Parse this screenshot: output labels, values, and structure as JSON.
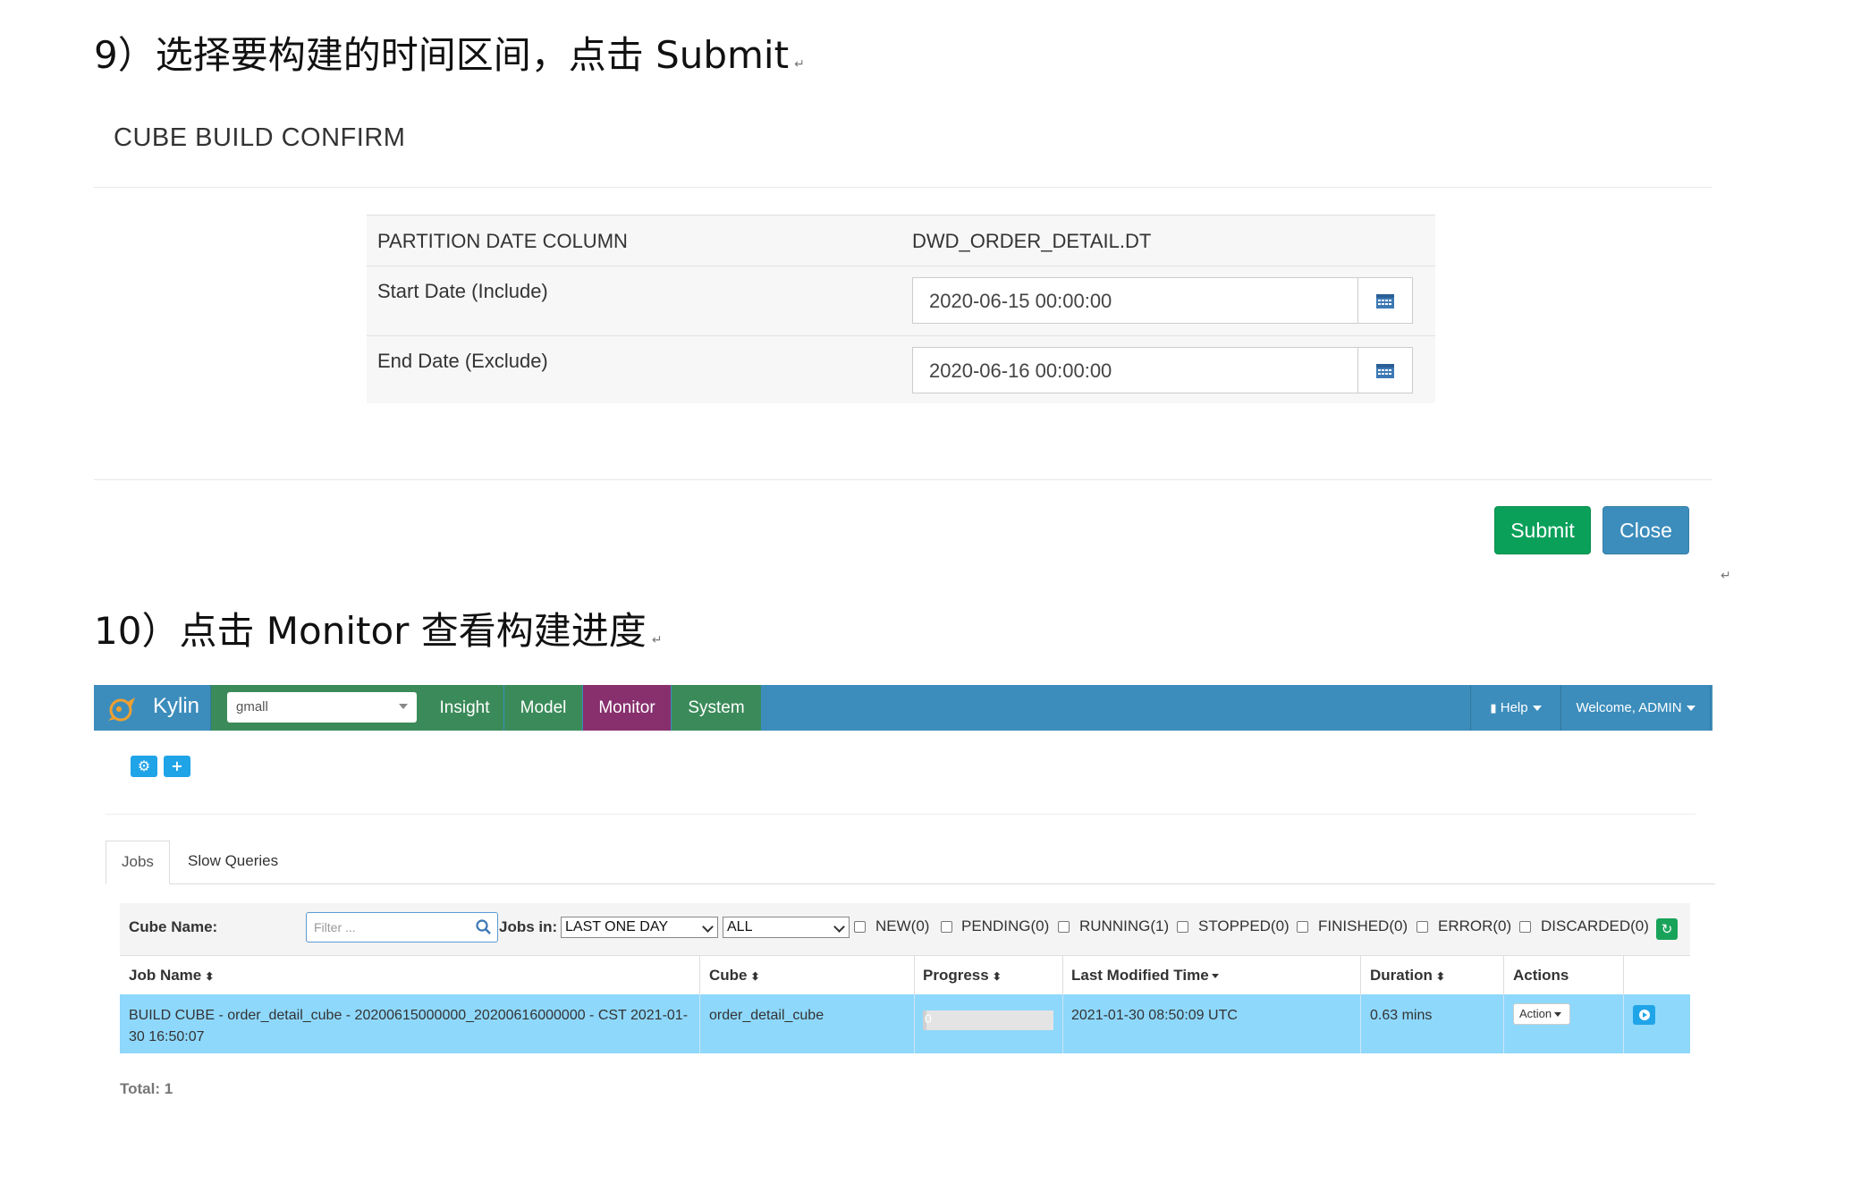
{
  "step9": {
    "heading": "9）选择要构建的时间区间，点击 Submit",
    "mark": "↵"
  },
  "modal": {
    "title": "CUBE BUILD CONFIRM",
    "partition_label": "PARTITION DATE COLUMN",
    "partition_value": "DWD_ORDER_DETAIL.DT",
    "start_label": "Start Date (Include)",
    "start_value": "2020-06-15 00:00:00",
    "end_label": "End Date (Exclude)",
    "end_value": "2020-06-16 00:00:00",
    "submit_label": "Submit",
    "close_label": "Close",
    "colors": {
      "submit": "#0aa05a",
      "close": "#3c8dbc"
    }
  },
  "return_mark": "↵",
  "step10": {
    "heading": "10）点击 Monitor 查看构建进度",
    "mark": "↵"
  },
  "kylin": {
    "brand": "Kylin",
    "project": "gmall",
    "nav": [
      "Insight",
      "Model",
      "Monitor",
      "System"
    ],
    "active_nav": "Monitor",
    "help": "Help",
    "welcome": "Welcome, ADMIN",
    "tabs": [
      "Jobs",
      "Slow Queries"
    ],
    "filter": {
      "cube_name_label": "Cube Name:",
      "placeholder": "Filter ...",
      "jobs_in_label": "Jobs in:",
      "time_range": "LAST ONE DAY",
      "status": "ALL",
      "checkboxes": [
        "NEW(0)",
        "PENDING(0)",
        "RUNNING(1)",
        "STOPPED(0)",
        "FINISHED(0)",
        "ERROR(0)",
        "DISCARDED(0)"
      ]
    },
    "table": {
      "headers": [
        "Job Name",
        "Cube",
        "Progress",
        "Last Modified Time",
        "Duration",
        "Actions"
      ],
      "row": {
        "job_name": "BUILD CUBE - order_detail_cube - 20200615000000_20200616000000 - CST 2021-01-30 16:50:07",
        "cube": "order_detail_cube",
        "progress": 0,
        "progress_label": "0",
        "last_modified": "2021-01-30 08:50:09 UTC",
        "duration": "0.63 mins",
        "action_label": "Action"
      }
    },
    "total": "Total: 1",
    "colors": {
      "navbar": "#3c8dbc",
      "nav_item": "#3b8b5a",
      "nav_active": "#87306d",
      "row_highlight": "#8ed8fc"
    }
  }
}
